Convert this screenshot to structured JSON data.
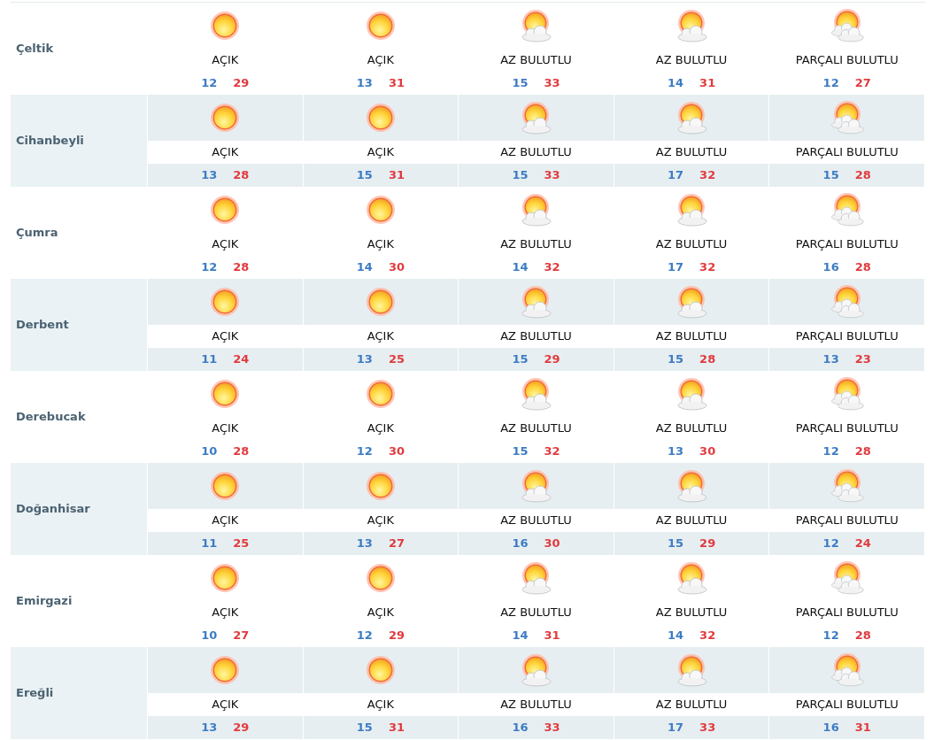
{
  "rows": [
    {
      "city": "Çeltik",
      "days": [
        {
          "kind": "clear",
          "condition": "AÇIK",
          "min": "12",
          "max": "29"
        },
        {
          "kind": "clear",
          "condition": "AÇIK",
          "min": "13",
          "max": "31"
        },
        {
          "kind": "few-clouds",
          "condition": "AZ BULUTLU",
          "min": "15",
          "max": "33"
        },
        {
          "kind": "few-clouds",
          "condition": "AZ BULUTLU",
          "min": "14",
          "max": "31"
        },
        {
          "kind": "partly-cloudy",
          "condition": "PARÇALI BULUTLU",
          "min": "12",
          "max": "27"
        }
      ]
    },
    {
      "city": "Cihanbeyli",
      "days": [
        {
          "kind": "clear",
          "condition": "AÇIK",
          "min": "13",
          "max": "28"
        },
        {
          "kind": "clear",
          "condition": "AÇIK",
          "min": "15",
          "max": "31"
        },
        {
          "kind": "few-clouds",
          "condition": "AZ BULUTLU",
          "min": "15",
          "max": "33"
        },
        {
          "kind": "few-clouds",
          "condition": "AZ BULUTLU",
          "min": "17",
          "max": "32"
        },
        {
          "kind": "partly-cloudy",
          "condition": "PARÇALI BULUTLU",
          "min": "15",
          "max": "28"
        }
      ]
    },
    {
      "city": "Çumra",
      "days": [
        {
          "kind": "clear",
          "condition": "AÇIK",
          "min": "12",
          "max": "28"
        },
        {
          "kind": "clear",
          "condition": "AÇIK",
          "min": "14",
          "max": "30"
        },
        {
          "kind": "few-clouds",
          "condition": "AZ BULUTLU",
          "min": "14",
          "max": "32"
        },
        {
          "kind": "few-clouds",
          "condition": "AZ BULUTLU",
          "min": "17",
          "max": "32"
        },
        {
          "kind": "partly-cloudy",
          "condition": "PARÇALI BULUTLU",
          "min": "16",
          "max": "28"
        }
      ]
    },
    {
      "city": "Derbent",
      "days": [
        {
          "kind": "clear",
          "condition": "AÇIK",
          "min": "11",
          "max": "24"
        },
        {
          "kind": "clear",
          "condition": "AÇIK",
          "min": "13",
          "max": "25"
        },
        {
          "kind": "few-clouds",
          "condition": "AZ BULUTLU",
          "min": "15",
          "max": "29"
        },
        {
          "kind": "few-clouds",
          "condition": "AZ BULUTLU",
          "min": "15",
          "max": "28"
        },
        {
          "kind": "partly-cloudy",
          "condition": "PARÇALI BULUTLU",
          "min": "13",
          "max": "23"
        }
      ]
    },
    {
      "city": "Derebucak",
      "days": [
        {
          "kind": "clear",
          "condition": "AÇIK",
          "min": "10",
          "max": "28"
        },
        {
          "kind": "clear",
          "condition": "AÇIK",
          "min": "12",
          "max": "30"
        },
        {
          "kind": "few-clouds",
          "condition": "AZ BULUTLU",
          "min": "15",
          "max": "32"
        },
        {
          "kind": "few-clouds",
          "condition": "AZ BULUTLU",
          "min": "13",
          "max": "30"
        },
        {
          "kind": "partly-cloudy",
          "condition": "PARÇALI BULUTLU",
          "min": "12",
          "max": "28"
        }
      ]
    },
    {
      "city": "Doğanhisar",
      "days": [
        {
          "kind": "clear",
          "condition": "AÇIK",
          "min": "11",
          "max": "25"
        },
        {
          "kind": "clear",
          "condition": "AÇIK",
          "min": "13",
          "max": "27"
        },
        {
          "kind": "few-clouds",
          "condition": "AZ BULUTLU",
          "min": "16",
          "max": "30"
        },
        {
          "kind": "few-clouds",
          "condition": "AZ BULUTLU",
          "min": "15",
          "max": "29"
        },
        {
          "kind": "partly-cloudy",
          "condition": "PARÇALI BULUTLU",
          "min": "12",
          "max": "24"
        }
      ]
    },
    {
      "city": "Emirgazi",
      "days": [
        {
          "kind": "clear",
          "condition": "AÇIK",
          "min": "10",
          "max": "27"
        },
        {
          "kind": "clear",
          "condition": "AÇIK",
          "min": "12",
          "max": "29"
        },
        {
          "kind": "few-clouds",
          "condition": "AZ BULUTLU",
          "min": "14",
          "max": "31"
        },
        {
          "kind": "few-clouds",
          "condition": "AZ BULUTLU",
          "min": "14",
          "max": "32"
        },
        {
          "kind": "partly-cloudy",
          "condition": "PARÇALI BULUTLU",
          "min": "12",
          "max": "28"
        }
      ]
    },
    {
      "city": "Ereğli",
      "days": [
        {
          "kind": "clear",
          "condition": "AÇIK",
          "min": "13",
          "max": "29"
        },
        {
          "kind": "clear",
          "condition": "AÇIK",
          "min": "15",
          "max": "31"
        },
        {
          "kind": "few-clouds",
          "condition": "AZ BULUTLU",
          "min": "16",
          "max": "33"
        },
        {
          "kind": "few-clouds",
          "condition": "AZ BULUTLU",
          "min": "17",
          "max": "33"
        },
        {
          "kind": "partly-cloudy",
          "condition": "PARÇALI BULUTLU",
          "min": "16",
          "max": "31"
        }
      ]
    }
  ]
}
